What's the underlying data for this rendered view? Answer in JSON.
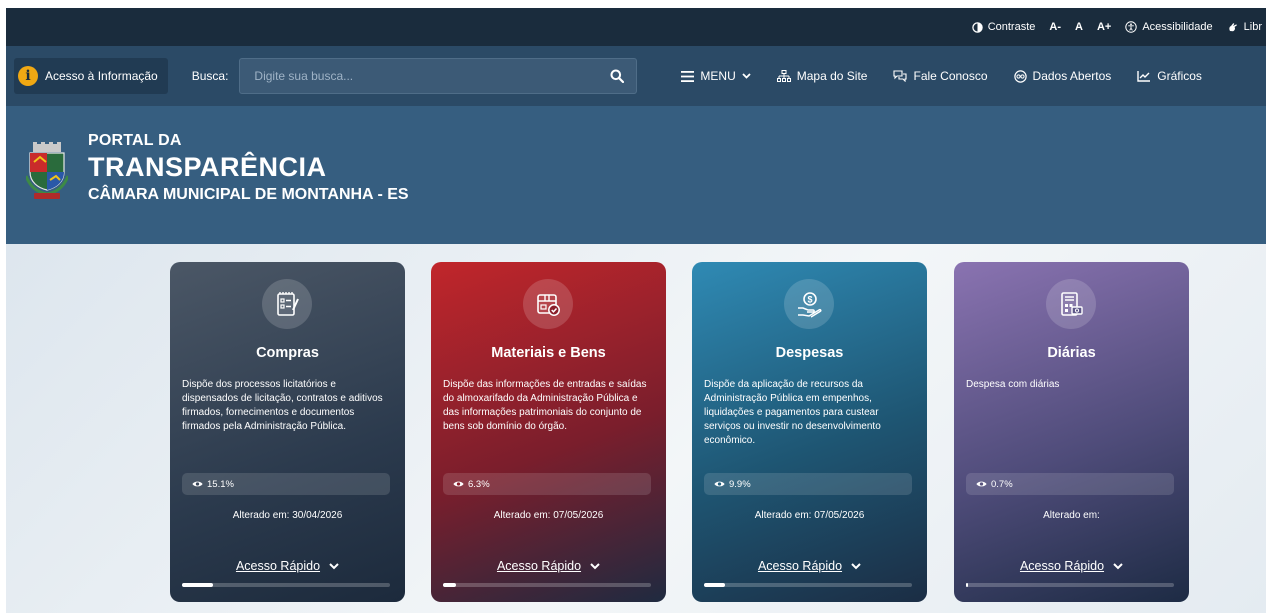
{
  "topbar": {
    "contraste": "Contraste",
    "font_minus": "A-",
    "font_normal": "A",
    "font_plus": "A+",
    "acessibilidade": "Acessibilidade",
    "libras": "Libr"
  },
  "nav": {
    "acesso_info": "Acesso à Informação",
    "busca_label": "Busca:",
    "search_placeholder": "Digite sua busca...",
    "menu": "MENU",
    "mapa": "Mapa do Site",
    "fale": "Fale Conosco",
    "dados": "Dados Abertos",
    "graficos": "Gráficos"
  },
  "banner": {
    "line1": "PORTAL DA",
    "line2": "TRANSPARÊNCIA",
    "line3": "CÂMARA MUNICIPAL DE MONTANHA - ES"
  },
  "cards": [
    {
      "title": "Compras",
      "icon": "purchases-checklist-icon",
      "description": "Dispõe dos processos licitatórios e dispensados de licitação, contratos e aditivos firmados, fornecimentos e documentos firmados pela Administração Pública.",
      "percent": "15.1%",
      "progress": 0.151,
      "changed": "Alterado em: 30/04/2026",
      "quick": "Acesso Rápido"
    },
    {
      "title": "Materiais e Bens",
      "icon": "box-check-icon",
      "description": "Dispõe das informações de entradas e saídas do almoxarifado da Administração Pública e das informações patrimoniais do conjunto de bens sob domínio do órgão.",
      "percent": "6.3%",
      "progress": 0.063,
      "changed": "Alterado em: 07/05/2026",
      "quick": "Acesso Rápido"
    },
    {
      "title": "Despesas",
      "icon": "hand-coin-icon",
      "description": "Dispõe da aplicação de recursos da Administração Pública em empenhos, liquidações e pagamentos para custear serviços ou investir no desenvolvimento econômico.",
      "percent": "9.9%",
      "progress": 0.099,
      "changed": "Alterado em: 07/05/2026",
      "quick": "Acesso Rápido"
    },
    {
      "title": "Diárias",
      "icon": "calculator-document-icon",
      "description": "Despesa com diárias",
      "percent": "0.7%",
      "progress": 0.007,
      "changed": "Alterado em:",
      "quick": "Acesso Rápido"
    }
  ],
  "colors": {
    "topbar": "#1a2c3d",
    "navbar": "#2b4a66",
    "banner": "#365e80",
    "accent_info": "#f0a813"
  }
}
